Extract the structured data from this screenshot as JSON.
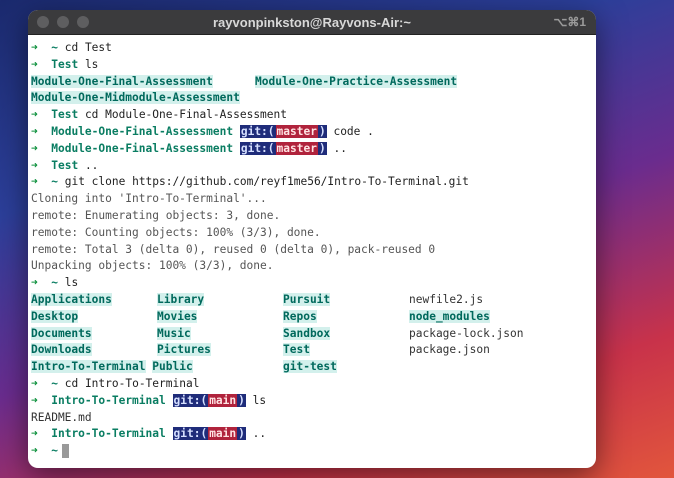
{
  "window": {
    "title": "rayvonpinkston@Rayvons-Air:~",
    "shortcut": "⌥⌘1"
  },
  "prompt": {
    "arrow": "➜",
    "home": "~",
    "git_label": "git:(",
    "git_close": ")"
  },
  "lines": {
    "l1_cmd": "cd Test",
    "l2_dir": "Test",
    "l2_cmd": "ls",
    "l3_a": "Module-One-Final-Assessment",
    "l3_b": "Module-One-Practice-Assessment",
    "l4_a": "Module-One-Midmodule-Assessment",
    "l5_dir": "Test",
    "l5_cmd": "cd Module-One-Final-Assessment",
    "l6_dir": "Module-One-Final-Assessment",
    "l6_branch": "master",
    "l6_cmd": "code .",
    "l7_dir": "Module-One-Final-Assessment",
    "l7_branch": "master",
    "l7_cmd": "..",
    "l8_dir": "Test",
    "l8_cmd": "..",
    "l9_cmd": "git clone https://github.com/reyf1me56/Intro-To-Terminal.git",
    "l10": "Cloning into 'Intro-To-Terminal'...",
    "l11": "remote: Enumerating objects: 3, done.",
    "l12": "remote: Counting objects: 100% (3/3), done.",
    "l13": "remote: Total 3 (delta 0), reused 0 (delta 0), pack-reused 0",
    "l14": "Unpacking objects: 100% (3/3), done.",
    "l15_cmd": "ls",
    "ls_rows": [
      [
        "Applications",
        "Library",
        "Pursuit",
        "newfile2.js"
      ],
      [
        "Desktop",
        "Movies",
        "Repos",
        "node_modules"
      ],
      [
        "Documents",
        "Music",
        "Sandbox",
        "package-lock.json"
      ],
      [
        "Downloads",
        "Pictures",
        "Test",
        "package.json"
      ]
    ],
    "ls_last_a": "Intro-To-Terminal",
    "ls_last_b": "Public",
    "ls_last_c": "git-test",
    "l21_cmd": "cd Intro-To-Terminal",
    "l22_dir": "Intro-To-Terminal",
    "l22_branch": "main",
    "l22_cmd": "ls",
    "l23": "README.md",
    "l24_dir": "Intro-To-Terminal",
    "l24_branch": "main",
    "l24_cmd": "..",
    "l25_home": "~"
  }
}
